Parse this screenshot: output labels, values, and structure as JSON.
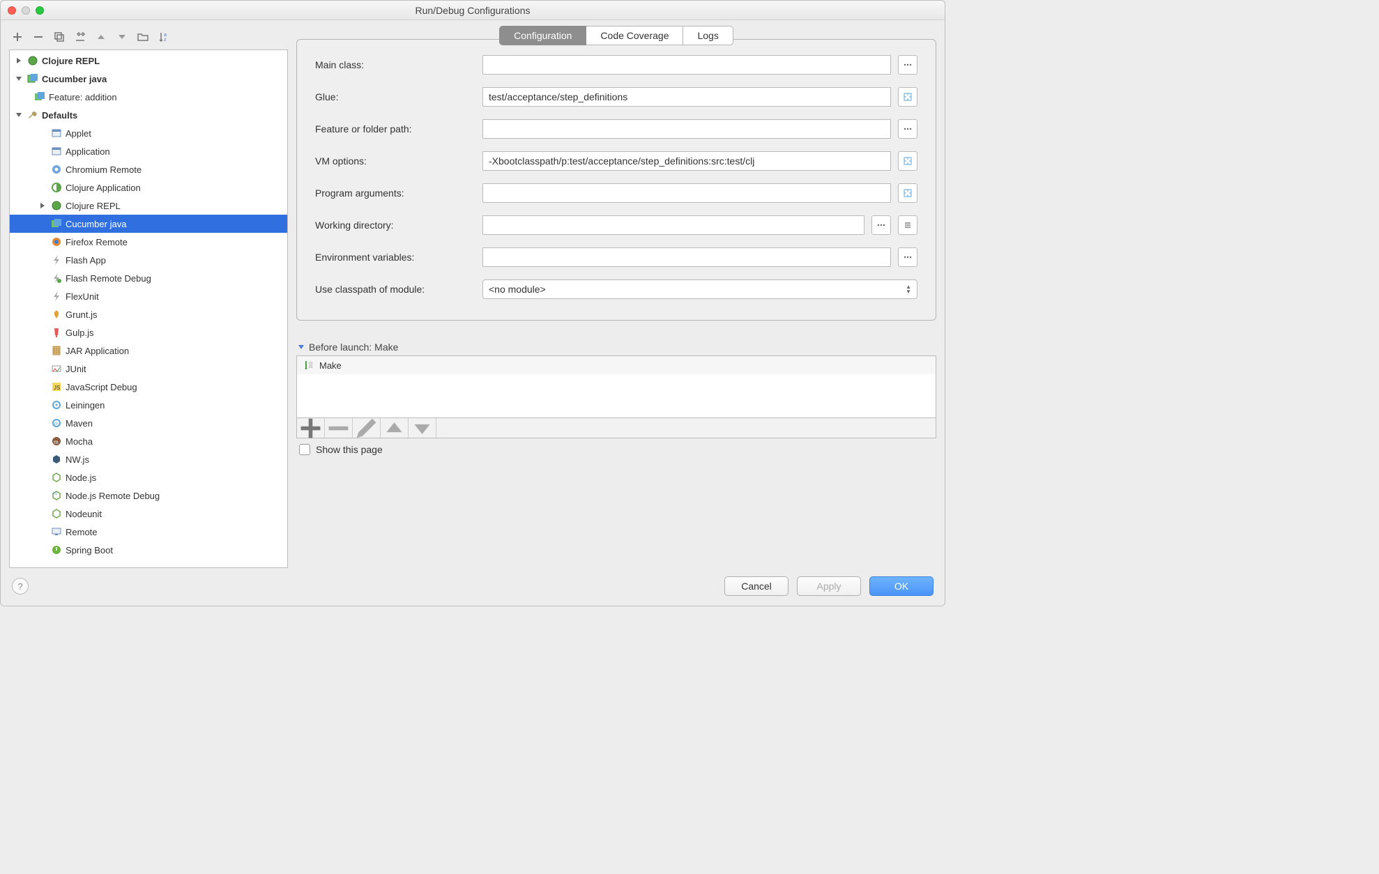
{
  "window": {
    "title": "Run/Debug Configurations"
  },
  "tree": {
    "clojure_repl": "Clojure REPL",
    "cucumber_java": "Cucumber java",
    "feature_addition": "Feature: addition",
    "defaults": "Defaults",
    "items": [
      "Applet",
      "Application",
      "Chromium Remote",
      "Clojure Application",
      "Clojure REPL",
      "Cucumber java",
      "Firefox Remote",
      "Flash App",
      "Flash Remote Debug",
      "FlexUnit",
      "Grunt.js",
      "Gulp.js",
      "JAR Application",
      "JUnit",
      "JavaScript Debug",
      "Leiningen",
      "Maven",
      "Mocha",
      "NW.js",
      "Node.js",
      "Node.js Remote Debug",
      "Nodeunit",
      "Remote",
      "Spring Boot"
    ]
  },
  "tabs": {
    "configuration": "Configuration",
    "coverage": "Code Coverage",
    "logs": "Logs"
  },
  "form": {
    "main_class_label": "Main class:",
    "main_class_value": "",
    "glue_label": "Glue:",
    "glue_value": "test/acceptance/step_definitions",
    "feature_label": "Feature or folder path:",
    "feature_value": "",
    "vm_label": "VM options:",
    "vm_value": "-Xbootclasspath/p:test/acceptance/step_definitions:src:test/clj",
    "args_label": "Program arguments:",
    "args_value": "",
    "wd_label": "Working directory:",
    "wd_value": "",
    "env_label": "Environment variables:",
    "env_value": "",
    "module_label": "Use classpath of module:",
    "module_value": "<no module>"
  },
  "before_launch": {
    "title": "Before launch: Make",
    "item": "Make",
    "show_page": "Show this page"
  },
  "buttons": {
    "cancel": "Cancel",
    "apply": "Apply",
    "ok": "OK"
  }
}
